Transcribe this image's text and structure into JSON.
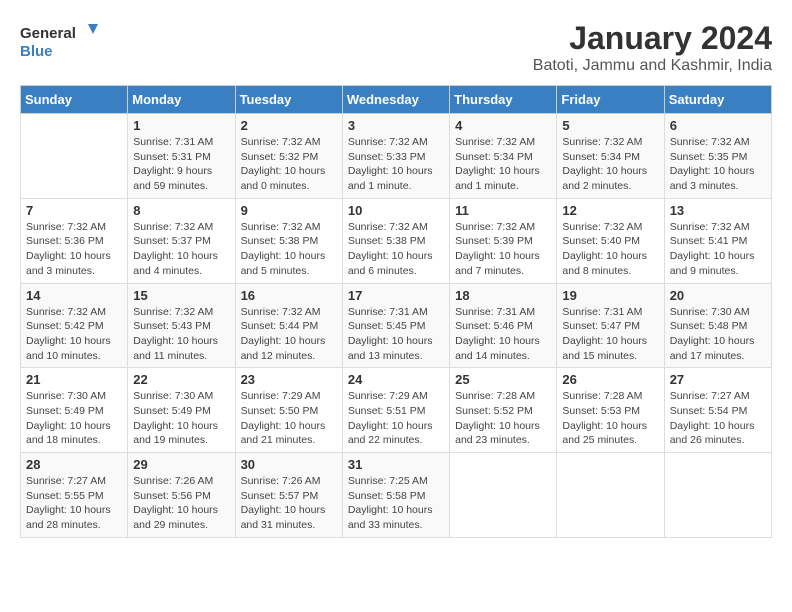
{
  "header": {
    "logo_line1": "General",
    "logo_line2": "Blue",
    "month": "January 2024",
    "location": "Batoti, Jammu and Kashmir, India"
  },
  "days_of_week": [
    "Sunday",
    "Monday",
    "Tuesday",
    "Wednesday",
    "Thursday",
    "Friday",
    "Saturday"
  ],
  "weeks": [
    [
      {
        "day": "",
        "info": ""
      },
      {
        "day": "1",
        "info": "Sunrise: 7:31 AM\nSunset: 5:31 PM\nDaylight: 9 hours\nand 59 minutes."
      },
      {
        "day": "2",
        "info": "Sunrise: 7:32 AM\nSunset: 5:32 PM\nDaylight: 10 hours\nand 0 minutes."
      },
      {
        "day": "3",
        "info": "Sunrise: 7:32 AM\nSunset: 5:33 PM\nDaylight: 10 hours\nand 1 minute."
      },
      {
        "day": "4",
        "info": "Sunrise: 7:32 AM\nSunset: 5:34 PM\nDaylight: 10 hours\nand 1 minute."
      },
      {
        "day": "5",
        "info": "Sunrise: 7:32 AM\nSunset: 5:34 PM\nDaylight: 10 hours\nand 2 minutes."
      },
      {
        "day": "6",
        "info": "Sunrise: 7:32 AM\nSunset: 5:35 PM\nDaylight: 10 hours\nand 3 minutes."
      }
    ],
    [
      {
        "day": "7",
        "info": "Sunrise: 7:32 AM\nSunset: 5:36 PM\nDaylight: 10 hours\nand 3 minutes."
      },
      {
        "day": "8",
        "info": "Sunrise: 7:32 AM\nSunset: 5:37 PM\nDaylight: 10 hours\nand 4 minutes."
      },
      {
        "day": "9",
        "info": "Sunrise: 7:32 AM\nSunset: 5:38 PM\nDaylight: 10 hours\nand 5 minutes."
      },
      {
        "day": "10",
        "info": "Sunrise: 7:32 AM\nSunset: 5:38 PM\nDaylight: 10 hours\nand 6 minutes."
      },
      {
        "day": "11",
        "info": "Sunrise: 7:32 AM\nSunset: 5:39 PM\nDaylight: 10 hours\nand 7 minutes."
      },
      {
        "day": "12",
        "info": "Sunrise: 7:32 AM\nSunset: 5:40 PM\nDaylight: 10 hours\nand 8 minutes."
      },
      {
        "day": "13",
        "info": "Sunrise: 7:32 AM\nSunset: 5:41 PM\nDaylight: 10 hours\nand 9 minutes."
      }
    ],
    [
      {
        "day": "14",
        "info": "Sunrise: 7:32 AM\nSunset: 5:42 PM\nDaylight: 10 hours\nand 10 minutes."
      },
      {
        "day": "15",
        "info": "Sunrise: 7:32 AM\nSunset: 5:43 PM\nDaylight: 10 hours\nand 11 minutes."
      },
      {
        "day": "16",
        "info": "Sunrise: 7:32 AM\nSunset: 5:44 PM\nDaylight: 10 hours\nand 12 minutes."
      },
      {
        "day": "17",
        "info": "Sunrise: 7:31 AM\nSunset: 5:45 PM\nDaylight: 10 hours\nand 13 minutes."
      },
      {
        "day": "18",
        "info": "Sunrise: 7:31 AM\nSunset: 5:46 PM\nDaylight: 10 hours\nand 14 minutes."
      },
      {
        "day": "19",
        "info": "Sunrise: 7:31 AM\nSunset: 5:47 PM\nDaylight: 10 hours\nand 15 minutes."
      },
      {
        "day": "20",
        "info": "Sunrise: 7:30 AM\nSunset: 5:48 PM\nDaylight: 10 hours\nand 17 minutes."
      }
    ],
    [
      {
        "day": "21",
        "info": "Sunrise: 7:30 AM\nSunset: 5:49 PM\nDaylight: 10 hours\nand 18 minutes."
      },
      {
        "day": "22",
        "info": "Sunrise: 7:30 AM\nSunset: 5:49 PM\nDaylight: 10 hours\nand 19 minutes."
      },
      {
        "day": "23",
        "info": "Sunrise: 7:29 AM\nSunset: 5:50 PM\nDaylight: 10 hours\nand 21 minutes."
      },
      {
        "day": "24",
        "info": "Sunrise: 7:29 AM\nSunset: 5:51 PM\nDaylight: 10 hours\nand 22 minutes."
      },
      {
        "day": "25",
        "info": "Sunrise: 7:28 AM\nSunset: 5:52 PM\nDaylight: 10 hours\nand 23 minutes."
      },
      {
        "day": "26",
        "info": "Sunrise: 7:28 AM\nSunset: 5:53 PM\nDaylight: 10 hours\nand 25 minutes."
      },
      {
        "day": "27",
        "info": "Sunrise: 7:27 AM\nSunset: 5:54 PM\nDaylight: 10 hours\nand 26 minutes."
      }
    ],
    [
      {
        "day": "28",
        "info": "Sunrise: 7:27 AM\nSunset: 5:55 PM\nDaylight: 10 hours\nand 28 minutes."
      },
      {
        "day": "29",
        "info": "Sunrise: 7:26 AM\nSunset: 5:56 PM\nDaylight: 10 hours\nand 29 minutes."
      },
      {
        "day": "30",
        "info": "Sunrise: 7:26 AM\nSunset: 5:57 PM\nDaylight: 10 hours\nand 31 minutes."
      },
      {
        "day": "31",
        "info": "Sunrise: 7:25 AM\nSunset: 5:58 PM\nDaylight: 10 hours\nand 33 minutes."
      },
      {
        "day": "",
        "info": ""
      },
      {
        "day": "",
        "info": ""
      },
      {
        "day": "",
        "info": ""
      }
    ]
  ]
}
